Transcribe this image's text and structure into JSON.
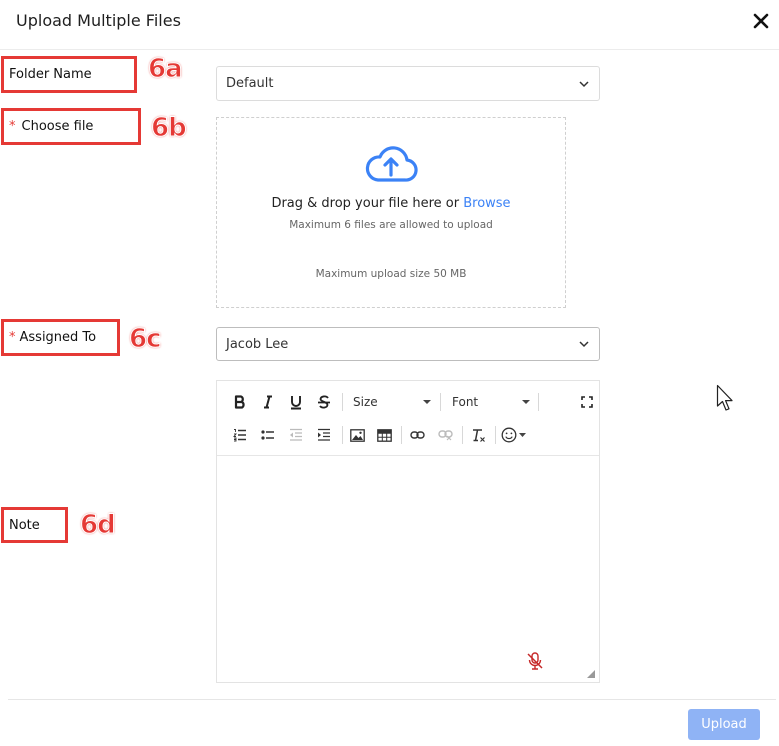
{
  "dialog": {
    "title": "Upload Multiple Files"
  },
  "labels": {
    "folder_name": "Folder Name",
    "choose_file": "Choose file",
    "assigned_to": "Assigned To",
    "note": "Note",
    "required_mark": "*"
  },
  "annotations": {
    "a": "6a",
    "b": "6b",
    "c": "6c",
    "d": "6d"
  },
  "folder_select": {
    "value": "Default"
  },
  "dropzone": {
    "main_text": "Drag & drop your file here or ",
    "browse_link": "Browse",
    "limit_text": "Maximum 6 files are allowed to upload",
    "size_text": "Maximum upload size 50 MB"
  },
  "assigned_select": {
    "value": "Jacob Lee"
  },
  "editor": {
    "toolbar": {
      "size_label": "Size",
      "font_label": "Font"
    }
  },
  "footer": {
    "upload_label": "Upload"
  },
  "colors": {
    "accent": "#3b82f6",
    "annotation": "#e53935",
    "upload_button": "#8fb3f5",
    "mic_muted": "#c62828"
  }
}
